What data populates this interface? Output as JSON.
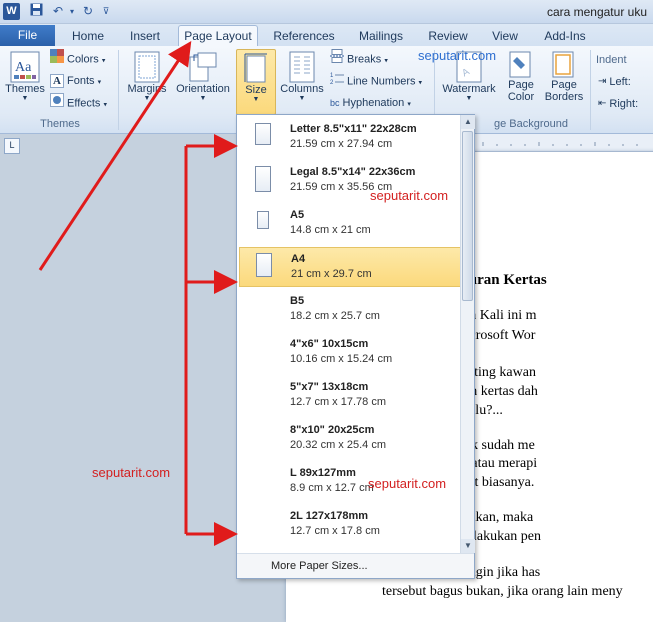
{
  "window": {
    "doc_title": "cara mengatur uku",
    "app_logo": "W"
  },
  "tabs": {
    "file": "File",
    "items": [
      "Home",
      "Insert",
      "Page Layout",
      "References",
      "Mailings",
      "Review",
      "View",
      "Add-Ins"
    ],
    "active": "Page Layout"
  },
  "ribbon": {
    "themes": {
      "themes_label": "Themes",
      "colors": "Colors",
      "fonts": "Fonts",
      "effects": "Effects",
      "group": "Themes"
    },
    "page_setup": {
      "margins": "Margins",
      "orientation": "Orientation",
      "size": "Size",
      "columns": "Columns",
      "breaks": "Breaks",
      "line_numbers": "Line Numbers",
      "hyphenation": "Hyphenation"
    },
    "page_background": {
      "watermark": "Watermark",
      "page_color_1": "Page",
      "page_color_2": "Color",
      "page_borders_1": "Page",
      "page_borders_2": "Borders",
      "group": "ge Background"
    },
    "paragraph": {
      "indent": "Indent",
      "left": "Left:",
      "right": "Right:"
    }
  },
  "watermarks": {
    "top": "seputarit.com",
    "middle": "seputarit.com",
    "left": "seputarit.com",
    "bottom": "seputarit.com"
  },
  "size_dropdown": {
    "items": [
      {
        "name": "Letter 8.5\"x11\" 22x28cm",
        "dims": "21.59 cm x 27.94 cm",
        "selected": false
      },
      {
        "name": "Legal 8.5\"x14\" 22x36cm",
        "dims": "21.59 cm x 35.56 cm",
        "selected": false
      },
      {
        "name": "A5",
        "dims": "14.8 cm x 21 cm",
        "selected": false
      },
      {
        "name": "A4",
        "dims": "21 cm x 29.7 cm",
        "selected": true
      },
      {
        "name": "B5",
        "dims": "18.2 cm x 25.7 cm",
        "selected": false
      },
      {
        "name": "4\"x6\" 10x15cm",
        "dims": "10.16 cm x 15.24 cm",
        "selected": false
      },
      {
        "name": "5\"x7\" 13x18cm",
        "dims": "12.7 cm x 17.78 cm",
        "selected": false
      },
      {
        "name": "8\"x10\" 20x25cm",
        "dims": "20.32 cm x 25.4 cm",
        "selected": false
      },
      {
        "name": "L 89x127mm",
        "dims": "8.9 cm x 12.7 cm",
        "selected": false
      },
      {
        "name": "2L 127x178mm",
        "dims": "12.7 cm x 17.8 cm",
        "selected": false
      }
    ],
    "more": "More Paper Sizes..."
  },
  "document": {
    "lines": [
      {
        "text": "Mengatur Ukuran Kertas",
        "bold": true
      },
      {
        "text": "r IT di Postingan Kali ini m",
        "bold": false
      },
      {
        "text": "an Kertas di Microsoft Wor",
        "bold": false
      },
      {
        "text": "an kertas itu penting kawan",
        "bold": false
      },
      {
        "text": "mengatur ukuran kertas dah",
        "bold": false
      },
      {
        "text": "ukuran kertas dulu?...",
        "bold": false
      },
      {
        "text": "mengetik banyak sudah me",
        "bold": false
      },
      {
        "text": "harus mengedit atau merapi",
        "bold": false
      },
      {
        "text": "ngan aturan surat biasanya.",
        "bold": false
      },
      {
        "text": "kerja dua kali bukan, maka",
        "bold": false
      },
      {
        "text": "wal sebelum melakukan pen",
        "bold": false
      },
      {
        "text": "nkah kita juga ingin jika has",
        "bold": false
      },
      {
        "text": "tersebut bagus bukan, jika orang lain meny",
        "bold": false
      }
    ]
  },
  "colors": {
    "accent": "#2b579a",
    "arrow": "#e01b1b",
    "selected_bg": "#fbd97c"
  }
}
